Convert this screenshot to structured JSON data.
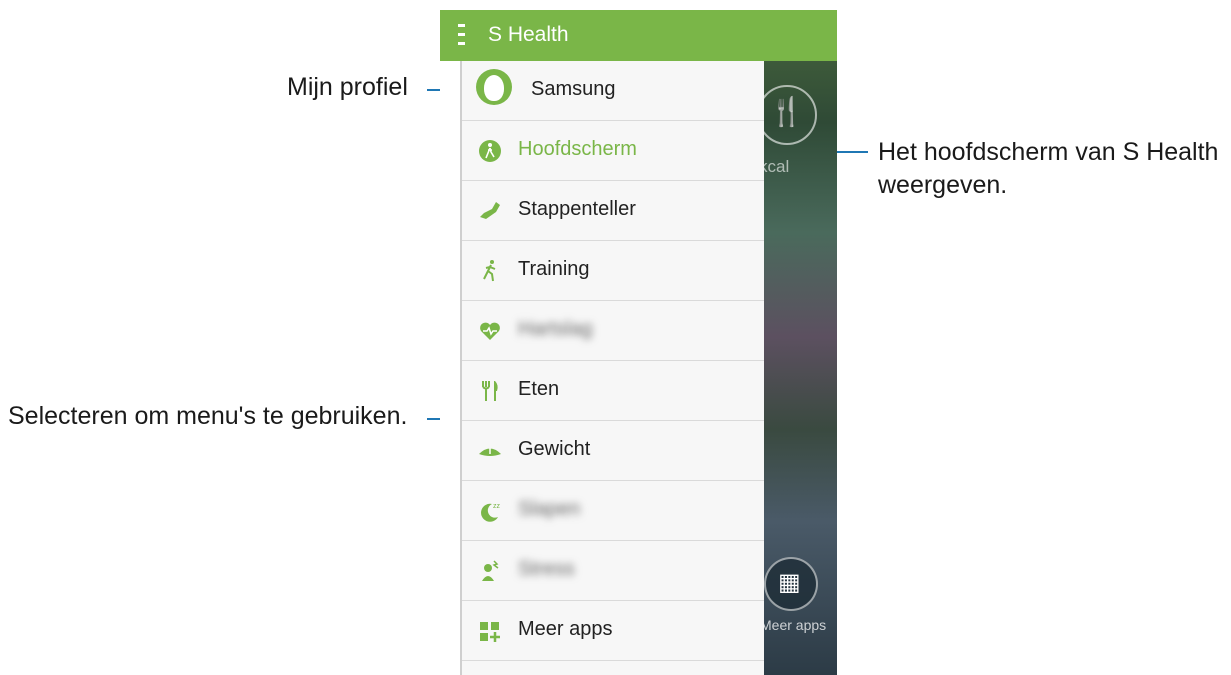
{
  "app": {
    "title": "S Health"
  },
  "callouts": {
    "profile": "Mijn profiel",
    "home_line1": "Het hoofdscherm van S Health",
    "home_line2": "weergeven.",
    "menus": "Selecteren om menu's te gebruiken."
  },
  "profile": {
    "name": "Samsung"
  },
  "menu": [
    {
      "label": "Hoofdscherm",
      "icon": "home-walker-icon",
      "active": true
    },
    {
      "label": "Stappenteller",
      "icon": "shoe-icon"
    },
    {
      "label": "Training",
      "icon": "runner-icon"
    },
    {
      "label": "Hartslag",
      "icon": "heart-pulse-icon",
      "blurred": true
    },
    {
      "label": "Eten",
      "icon": "fork-knife-icon"
    },
    {
      "label": "Gewicht",
      "icon": "scale-icon"
    },
    {
      "label": "Slapen",
      "icon": "moon-sleep-icon",
      "blurred": true
    },
    {
      "label": "Stress",
      "icon": "stress-icon",
      "blurred": true
    },
    {
      "label": "Meer apps",
      "icon": "grid-plus-icon"
    }
  ],
  "background": {
    "kcal": "kcal",
    "more_apps": "Meer apps"
  },
  "colors": {
    "accent": "#7ab648",
    "callout_line": "#1f77b4"
  }
}
